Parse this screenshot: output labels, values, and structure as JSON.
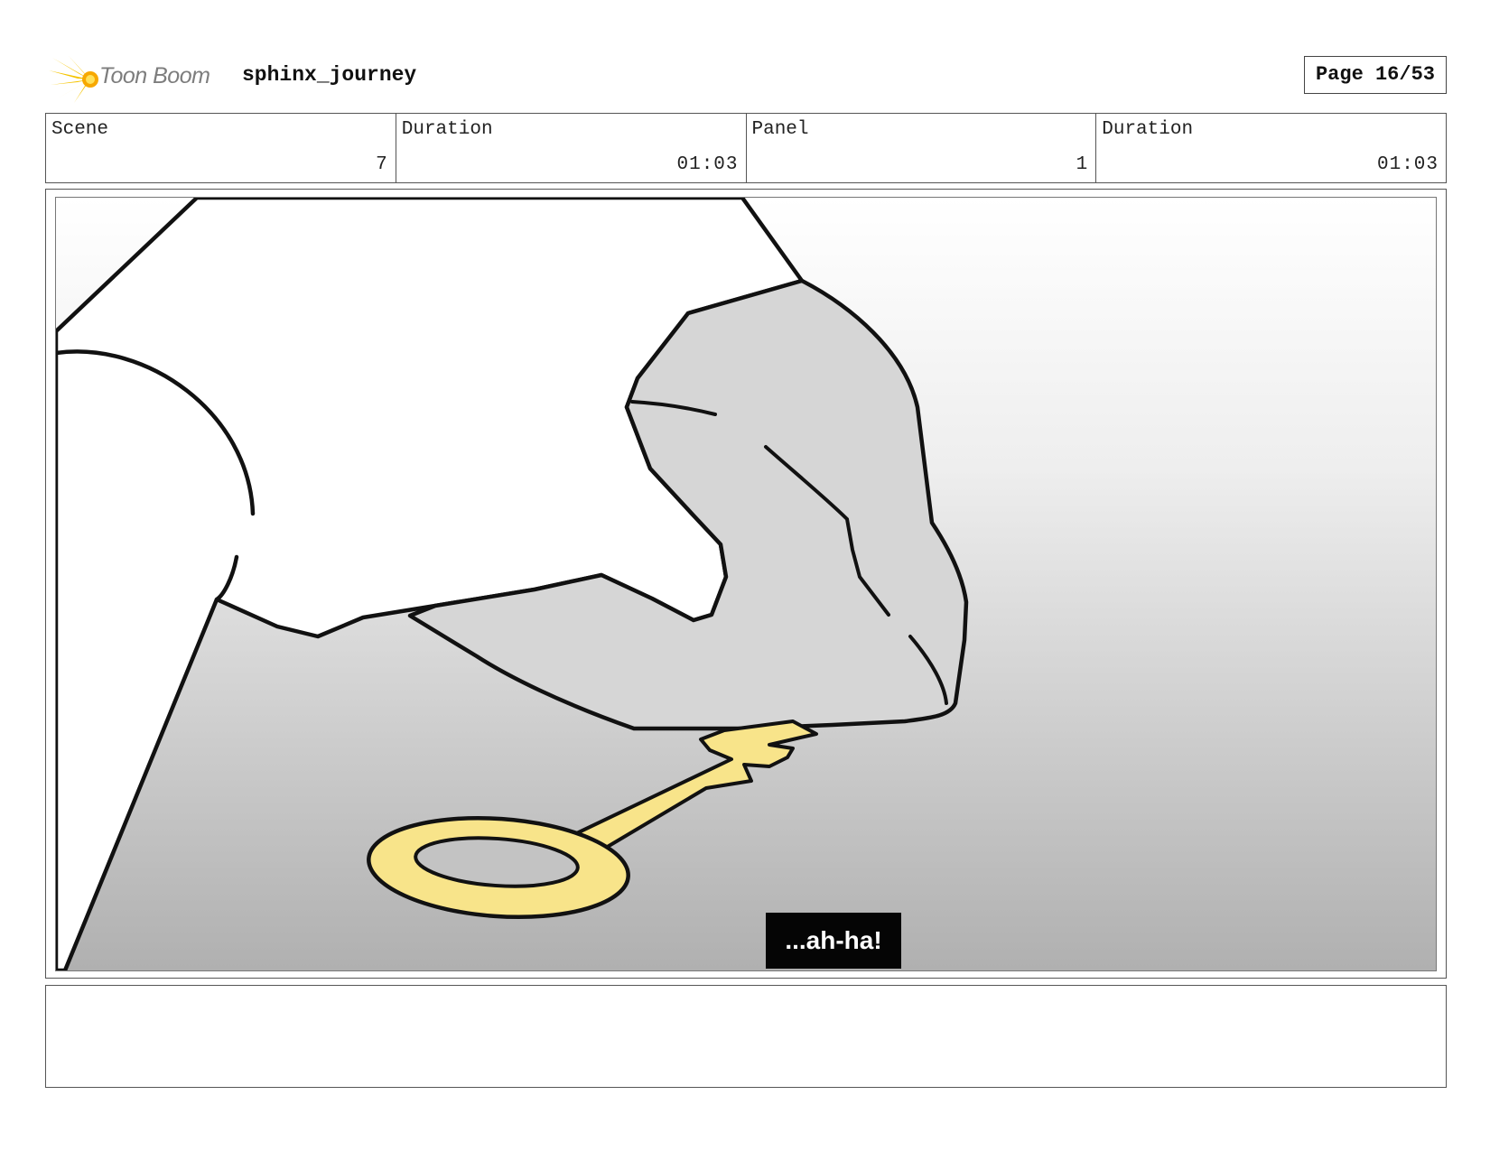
{
  "header": {
    "logo_text": "Toon Boom",
    "project_title": "sphinx_journey",
    "page_label": "Page 16/53"
  },
  "info": {
    "scene_label": "Scene",
    "scene_value": "7",
    "scene_duration_label": "Duration",
    "scene_duration_value": "01:03",
    "panel_label": "Panel",
    "panel_value": "1",
    "panel_duration_label": "Duration",
    "panel_duration_value": "01:03"
  },
  "panel": {
    "subtitle": "...ah-ha!"
  },
  "notes": {
    "text": ""
  },
  "colors": {
    "key_fill": "#f8e48a",
    "rock_fill": "#d6d6d6",
    "logo_accent": "#f5c400"
  }
}
